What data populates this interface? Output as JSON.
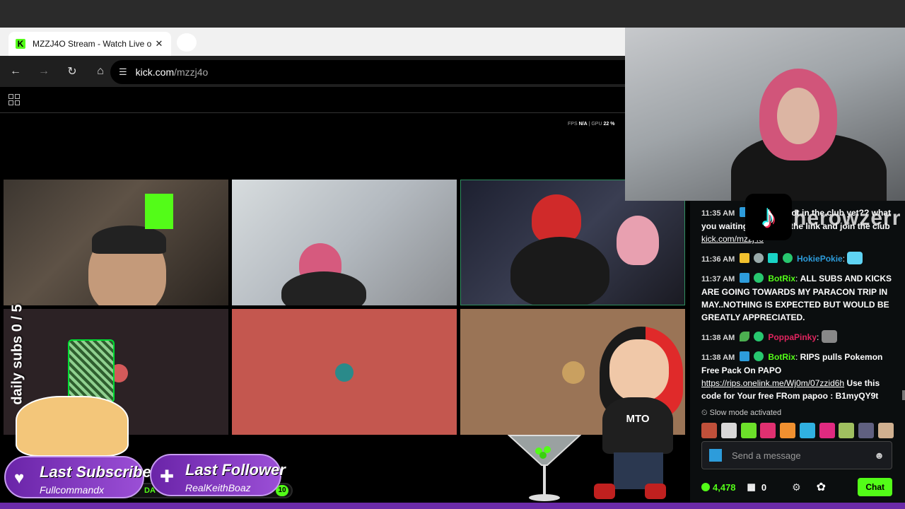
{
  "browser": {
    "tab_title": "MZZJ4O Stream - Watch Live o",
    "tab_favicon_letter": "K",
    "url_host": "kick.com",
    "url_path": "/mzzj4o"
  },
  "stats": {
    "fps_label": "FPS",
    "fps_value": "N/A",
    "gpu_label": "GPU",
    "gpu_value": "22 %"
  },
  "overlay": {
    "tiktok_name": "herowzerr",
    "daily_subs": "daily subs 0 / 5",
    "last_subscriber_label": "Last Subscriber",
    "last_subscriber_name": "Fullcommandx",
    "last_follower_label": "Last Follower",
    "last_follower_name": "RealKeithBoaz",
    "bar_text": "DA",
    "bar_number": "10",
    "mascot_text": "MTO"
  },
  "chat": {
    "messages": [
      {
        "time": "11:35 AM",
        "user": "",
        "user_color": "#ffffff",
        "text": "are you not in the club yet?? what you waiting for? click the link and join the club",
        "link": "kick.com/mzzj4o"
      },
      {
        "time": "11:36 AM",
        "user": "HokiePokie",
        "user_color": "#2d9cdb",
        "text": "",
        "link": ""
      },
      {
        "time": "11:37 AM",
        "user": "BotRix",
        "user_color": "#53fc18",
        "text": "ALL SUBS AND KICKS ARE GOING TOWARDS MY PARACON TRIP IN MAY..NOTHING IS EXPECTED BUT WOULD BE GREATLY APPRECIATED.",
        "link": ""
      },
      {
        "time": "11:38 AM",
        "user": "PoppaPinky",
        "user_color": "#e0245e",
        "text": "",
        "link": ""
      },
      {
        "time": "11:38 AM",
        "user": "BotRix",
        "user_color": "#53fc18",
        "text": "RIPS pulls Pokemon Free Pack On PAPO",
        "link": "https://rips.onelink.me/Wj0m/07zzid6h",
        "text_after": "Use this code for Your free FRom papoo : B1myQY9t"
      }
    ],
    "slow_mode": "Slow mode activated",
    "input_placeholder": "Send a message",
    "kicks_count": "4,478",
    "store_count": "0",
    "chat_button": "Chat"
  },
  "colors": {
    "kick_green": "#53fc18",
    "alert_purple": "#7b2fbe"
  }
}
